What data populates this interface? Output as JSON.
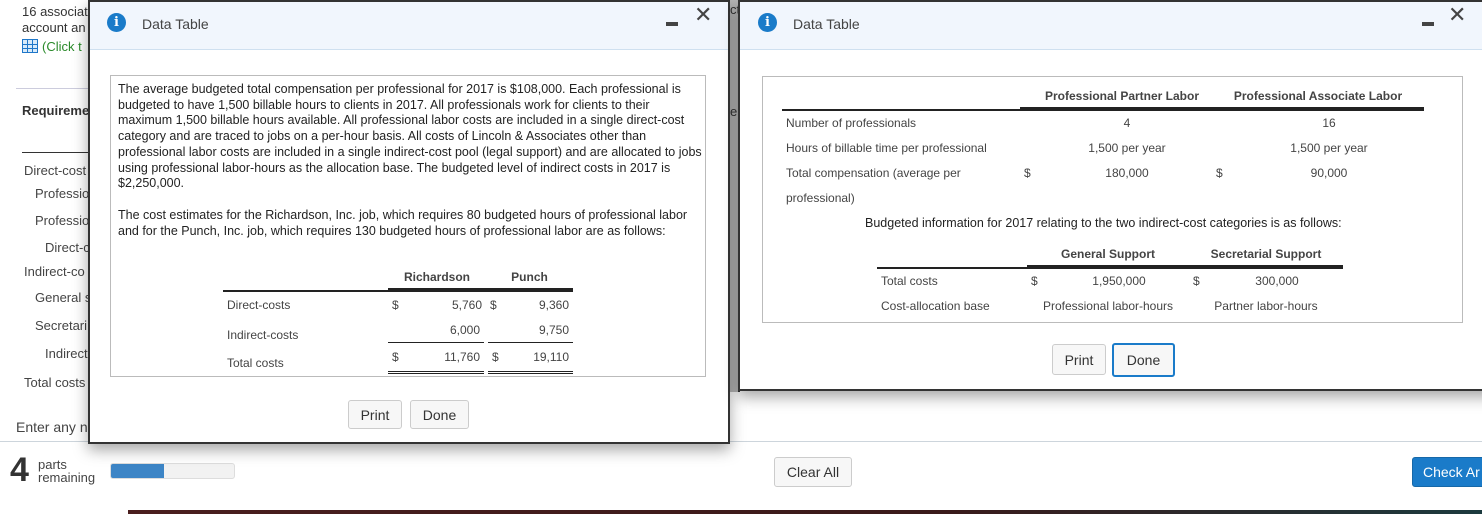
{
  "background": {
    "intro_line1": "16 associat",
    "intro_line2": "account an",
    "click_link": "(Click t",
    "requirements_label": "Requireme",
    "rows": [
      "Direct-cost",
      "Professio",
      "Professio",
      "Direct-c",
      "Indirect-co",
      "General s",
      "Secretari",
      "Indirect",
      "Total costs"
    ],
    "enter_prompt": "Enter any n",
    "parts_count": "4",
    "parts_label_1": "parts",
    "parts_label_2": "remaining",
    "progress_fraction": 0.43,
    "fragment_1": "ct",
    "fragment_2": "e",
    "clear_all_label": "Clear All",
    "check_answer_label": "Check Ar"
  },
  "dialog_left": {
    "title": "Data Table",
    "icon": "info-icon",
    "paragraph1": "The average budgeted total compensation per professional for 2017 is $108,000. Each professional is budgeted to have 1,500 billable hours to clients in 2017. All professionals work for clients to their maximum 1,500 billable hours available. All professional labor costs are included in a single direct-cost category and are traced to jobs on a per-hour basis. All costs of Lincoln & Associates other than professional labor costs are included in a single indirect-cost pool (legal support) and are allocated to jobs using professional labor-hours as the allocation base. The budgeted level of indirect costs in 2017 is $2,250,000.",
    "paragraph2": "The cost estimates for the Richardson, Inc. job, which requires 80 budgeted hours of professional labor and for the Punch, Inc. job, which requires 130 budgeted hours of professional labor are as follows:",
    "table": {
      "headers": [
        "Richardson",
        "Punch"
      ],
      "rows": [
        {
          "label": "Direct-costs",
          "c1": "$",
          "v1": "5,760",
          "c2": "$",
          "v2": "9,360"
        },
        {
          "label": "Indirect-costs",
          "c1": "",
          "v1": "6,000",
          "c2": "",
          "v2": "9,750"
        },
        {
          "label": "Total costs",
          "c1": "$",
          "v1": "11,760",
          "c2": "$",
          "v2": "19,110"
        }
      ]
    },
    "print_label": "Print",
    "done_label": "Done"
  },
  "dialog_right": {
    "title": "Data Table",
    "icon": "info-icon",
    "table1": {
      "headers": [
        "Professional Partner Labor",
        "Professional Associate Labor"
      ],
      "rows": [
        {
          "label": "Number of professionals",
          "c1": "",
          "v1": "4",
          "c2": "",
          "v2": "16"
        },
        {
          "label": "Hours of billable time per professional",
          "c1": "",
          "v1": "1,500 per year",
          "c2": "",
          "v2": "1,500 per year"
        },
        {
          "label": "Total compensation (average per",
          "c1": "$",
          "v1": "180,000",
          "c2": "$",
          "v2": "90,000"
        },
        {
          "label": "professional)",
          "c1": "",
          "v1": "",
          "c2": "",
          "v2": ""
        }
      ]
    },
    "budget_intro": "Budgeted information for 2017 relating to the two indirect-cost categories is as follows:",
    "table2": {
      "headers": [
        "General Support",
        "Secretarial Support"
      ],
      "rows": [
        {
          "label": "Total costs",
          "c1": "$",
          "v1": "1,950,000",
          "c2": "$",
          "v2": "300,000"
        },
        {
          "label": "Cost-allocation base",
          "v1": "Professional labor-hours",
          "v2": "Partner labor-hours"
        }
      ]
    },
    "print_label": "Print",
    "done_label": "Done"
  }
}
